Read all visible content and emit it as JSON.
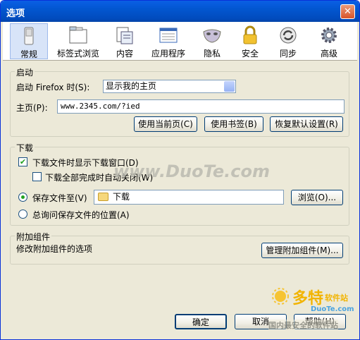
{
  "window": {
    "title": "选项",
    "close": "✕"
  },
  "toolbar": {
    "tabs": [
      {
        "label": "常规",
        "icon": "switch-icon"
      },
      {
        "label": "标签式浏览",
        "icon": "tabs-icon"
      },
      {
        "label": "内容",
        "icon": "content-page-icon"
      },
      {
        "label": "应用程序",
        "icon": "applications-icon"
      },
      {
        "label": "隐私",
        "icon": "mask-icon"
      },
      {
        "label": "安全",
        "icon": "lock-icon"
      },
      {
        "label": "同步",
        "icon": "sync-icon"
      },
      {
        "label": "高级",
        "icon": "gear-icon"
      }
    ],
    "selected": "常规"
  },
  "startup": {
    "group_label": "启动",
    "when_label": "启动 Firefox 时(S):",
    "when_value": "显示我的主页",
    "home_label": "主页(P):",
    "home_value": "www.2345.com/?ied",
    "btn_current": "使用当前页(C)",
    "btn_bookmark": "使用书签(B)",
    "btn_restore": "恢复默认设置(R)"
  },
  "downloads": {
    "group_label": "下载",
    "show_window_label": "下载文件时显示下载窗口(D)",
    "show_window_checked": true,
    "close_when_done_label": "下载全部完成时自动关闭(W)",
    "close_when_done_checked": false,
    "save_to_label": "保存文件至(V)",
    "save_to_selected": true,
    "folder_value": "下载",
    "browse_label": "浏览(O)...",
    "always_ask_label": "总询问保存文件的位置(A)",
    "always_ask_selected": false
  },
  "addons": {
    "group_label": "附加组件",
    "description": "修改附加组件的选项",
    "manage_label": "管理附加组件(M)..."
  },
  "footer": {
    "ok": "确定",
    "cancel": "取消",
    "help": "帮助(H)"
  },
  "watermarks": {
    "center": "www.DuoTe.com",
    "logo_main": "多特",
    "logo_sub": "软件站",
    "logo_url": "DuoTe.com",
    "logo_tagline": "国内最安全的软件站"
  },
  "colors": {
    "accent": "#0a5fe5",
    "selected_tab": "#d8e4f8",
    "dialog_bg": "#ece9d8",
    "check": "#21a121"
  }
}
